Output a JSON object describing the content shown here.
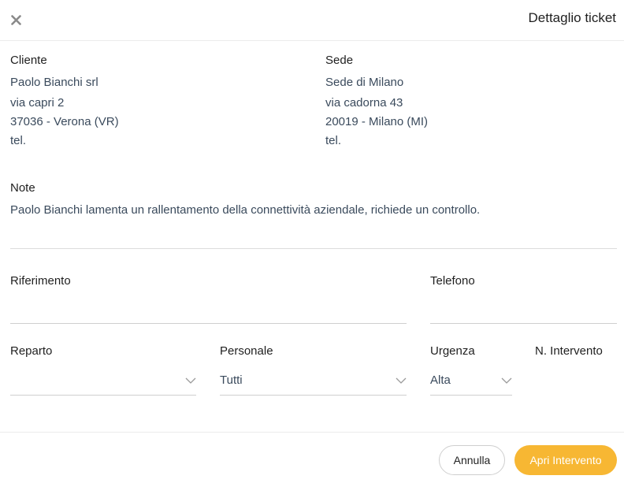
{
  "header": {
    "title": "Dettaglio ticket",
    "close_icon": "close-icon"
  },
  "cliente": {
    "label": "Cliente",
    "name": "Paolo Bianchi srl",
    "address": "via capri 2",
    "city": "37036 - Verona (VR)",
    "tel": "tel."
  },
  "sede": {
    "label": "Sede",
    "name": "Sede di Milano",
    "address": "via cadorna 43",
    "city": "20019 - Milano (MI)",
    "tel": "tel."
  },
  "note": {
    "label": "Note",
    "text": "Paolo Bianchi lamenta un rallentamento della connettività aziendale, richiede un controllo."
  },
  "form": {
    "riferimento": {
      "label": "Riferimento",
      "value": ""
    },
    "telefono": {
      "label": "Telefono",
      "value": ""
    },
    "reparto": {
      "label": "Reparto",
      "value": ""
    },
    "personale": {
      "label": "Personale",
      "value": "Tutti"
    },
    "urgenza": {
      "label": "Urgenza",
      "value": "Alta"
    },
    "n_intervento": {
      "label": "N. Intervento"
    }
  },
  "footer": {
    "cancel_label": "Annulla",
    "submit_label": "Apri Intervento"
  },
  "colors": {
    "accent": "#f7b733",
    "text_secondary": "#3a4a5c"
  }
}
